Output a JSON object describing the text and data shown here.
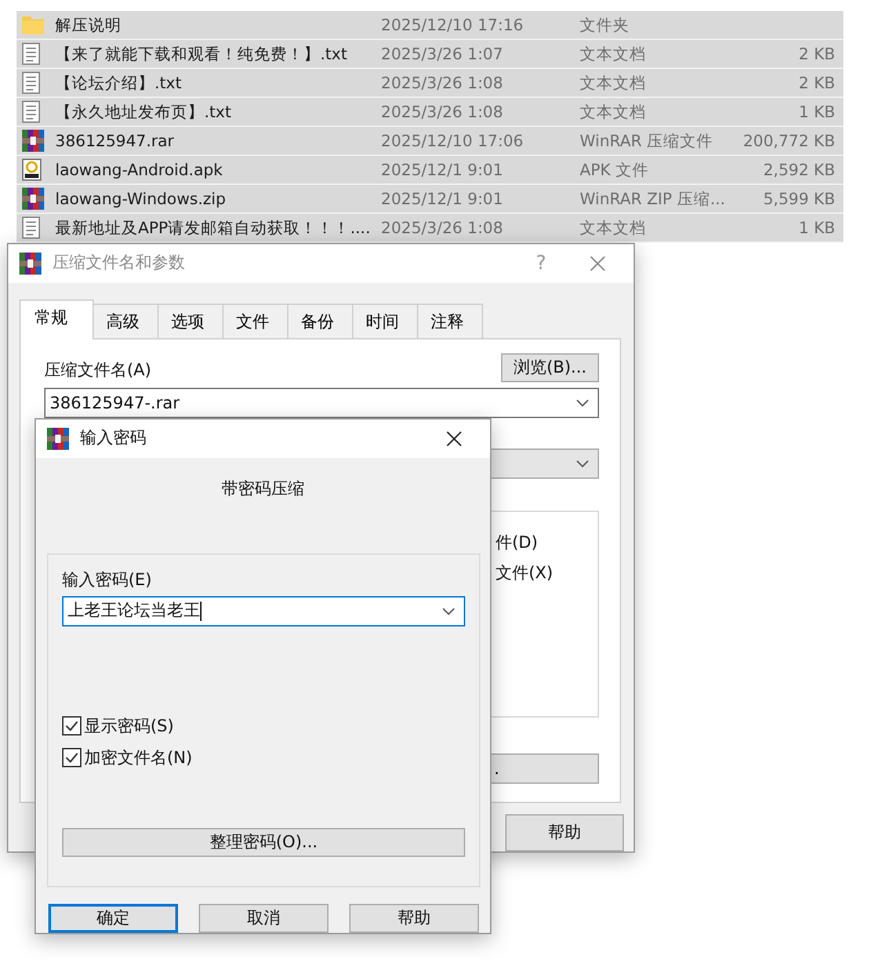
{
  "files": [
    {
      "name": "解压说明",
      "date": "2025/12/10 17:16",
      "type": "文件夹",
      "kind": "folder"
    },
    {
      "name": "【来了就能下载和观看！纯免费！】.txt",
      "date": "2025/3/26 1:07",
      "type": "文本文档",
      "size": "2 KB",
      "kind": "text"
    },
    {
      "name": "【论坛介绍】.txt",
      "date": "2025/3/26 1:08",
      "type": "文本文档",
      "size": "2 KB",
      "kind": "text"
    },
    {
      "name": "【永久地址发布页】.txt",
      "date": "2025/3/26 1:08",
      "type": "文本文档",
      "size": "1 KB",
      "kind": "text"
    },
    {
      "name": "386125947.rar",
      "date": "2025/12/10 17:06",
      "type": "WinRAR 压缩文件",
      "size": "200,772 KB",
      "kind": "rar"
    },
    {
      "name": "laowang-Android.apk",
      "date": "2025/12/1 9:01",
      "type": "APK 文件",
      "size": "2,592 KB",
      "kind": "apk"
    },
    {
      "name": "laowang-Windows.zip",
      "date": "2025/12/1 9:01",
      "type": "WinRAR ZIP 压缩...",
      "size": "5,599 KB",
      "kind": "rar"
    },
    {
      "name": "最新地址及APP请发邮箱自动获取！！！....",
      "date": "2025/3/26 1:08",
      "type": "文本文档",
      "size": "1 KB",
      "kind": "text"
    }
  ],
  "archive_dialog": {
    "title": "压缩文件名和参数",
    "help_mark": "?",
    "tabs": [
      {
        "label": "常规",
        "selected": true
      },
      {
        "label": "高级",
        "selected": false
      },
      {
        "label": "选项",
        "selected": false
      },
      {
        "label": "文件",
        "selected": false
      },
      {
        "label": "备份",
        "selected": false
      },
      {
        "label": "时间",
        "selected": false
      },
      {
        "label": "注释",
        "selected": false
      }
    ],
    "archive_name_label": "压缩文件名(A)",
    "browse_button": "浏览(B)...",
    "archive_name": "386125947-.rar",
    "option_fragments": [
      "件(D)",
      "文件(X)"
    ],
    "button_fragment": ".",
    "help_button": "帮助"
  },
  "password_dialog": {
    "title": "输入密码",
    "heading": "带密码压缩",
    "password_label": "输入密码(E)",
    "password": "上老王论坛当老王",
    "checkboxes": [
      {
        "label": "显示密码(S)",
        "checked": true
      },
      {
        "label": "加密文件名(N)",
        "checked": true
      }
    ],
    "organize_button": "整理密码(O)...",
    "buttons": [
      {
        "label": "确定",
        "default": true
      },
      {
        "label": "取消",
        "default": false
      },
      {
        "label": "帮助",
        "default": false
      }
    ]
  }
}
